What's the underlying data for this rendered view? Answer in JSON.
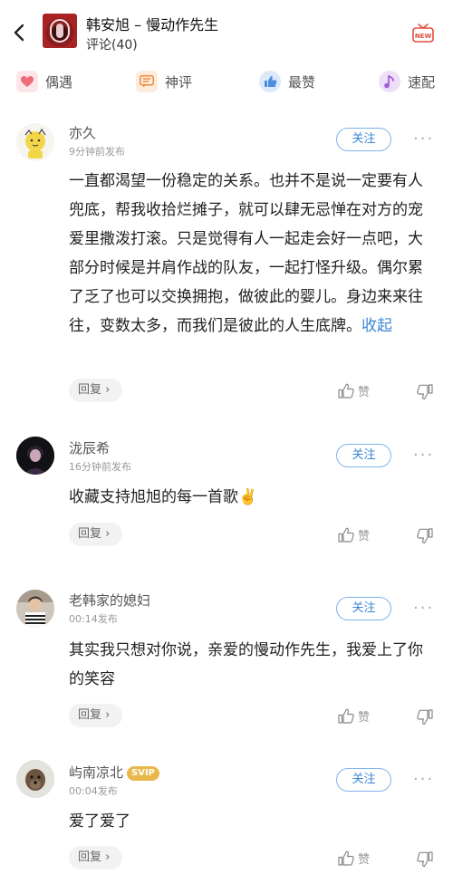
{
  "header": {
    "song_title": "韩安旭 – 慢动作先生",
    "comment_count": "评论(40)"
  },
  "tabs": [
    {
      "label": "偶遇",
      "icon": "heart-icon",
      "color": "#f08a96"
    },
    {
      "label": "神评",
      "icon": "chat-icon",
      "color": "#f2a05e"
    },
    {
      "label": "最赞",
      "icon": "thumb-icon",
      "color": "#4a8ee0"
    },
    {
      "label": "速配",
      "icon": "music-note-icon",
      "color": "#b079d8"
    }
  ],
  "actions": {
    "follow": "关注",
    "reply": "回复",
    "reply_arrow": "›",
    "like": "赞",
    "more": "···",
    "collapse": "收起"
  },
  "comments": [
    {
      "user": "亦久",
      "time": "9分钟前发布",
      "text": "一直都渴望一份稳定的关系。也并不是说一定要有人兜底，帮我收拾烂摊子，就可以肆无忌惮在对方的宠爱里撒泼打滚。只是觉得有人一起走会好一点吧，大部分时候是并肩作战的队友，一起打怪升级。偶尔累了乏了也可以交换拥抱，做彼此的婴儿。身边来来往往，变数太多，而我们是彼此的人生底牌。"
    },
    {
      "user": "泷辰希",
      "time": "16分钟前发布",
      "text": "收藏支持旭旭的每一首歌✌️"
    },
    {
      "user": "老韩家的媳妇",
      "time": "00:14发布",
      "text": "其实我只想对你说，亲爱的慢动作先生，我爱上了你的笑容"
    },
    {
      "user": "屿南凉北",
      "badge": "SVIP",
      "time": "00:04发布",
      "text": "爱了爱了"
    }
  ]
}
